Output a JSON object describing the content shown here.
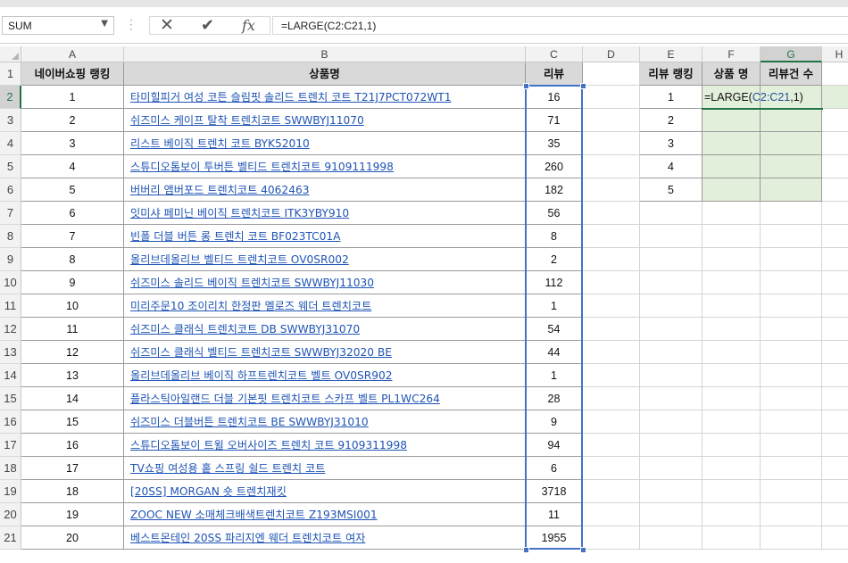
{
  "formula_bar": {
    "name_box": "SUM",
    "cancel_icon": "✕",
    "enter_icon": "✔",
    "fx_icon": "fx",
    "formula": "=LARGE(C2:C21,1)"
  },
  "columns": [
    "A",
    "B",
    "C",
    "D",
    "E",
    "F",
    "G",
    "H"
  ],
  "rows": [
    "1",
    "2",
    "3",
    "4",
    "5",
    "6",
    "7",
    "8",
    "9",
    "10",
    "11",
    "12",
    "13",
    "14",
    "15",
    "16",
    "17",
    "18",
    "19",
    "20",
    "21"
  ],
  "table": {
    "headers": [
      "네이버쇼핑 랭킹",
      "상품명",
      "리뷰"
    ],
    "rows": [
      {
        "rank": "1",
        "name": "타미힐피거 여성 코튼 슬림핏 솔리드 트렌치 코트 T21J7PCT072WT1",
        "reviews": "16"
      },
      {
        "rank": "2",
        "name": "쉬즈미스 케이프 탈착 트렌치코트 SWWBYJ11070",
        "reviews": "71"
      },
      {
        "rank": "3",
        "name": "리스트 베이직 트렌치 코트 BYK52010",
        "reviews": "35"
      },
      {
        "rank": "4",
        "name": "스튜디오톰보이 투버튼 벨티드 트렌치코트 9109111998",
        "reviews": "260"
      },
      {
        "rank": "5",
        "name": "버버리 앰버포드 트렌치코트 4062463",
        "reviews": "182"
      },
      {
        "rank": "6",
        "name": "잇미샤 페미닌 베이직 트렌치코트 ITK3YBY910",
        "reviews": "56"
      },
      {
        "rank": "7",
        "name": "빈폴 더블 버튼 롱 트렌치 코트 BF023TC01A",
        "reviews": "8"
      },
      {
        "rank": "8",
        "name": "올리브데올리브 벨티드 트렌치코트 OV0SR002",
        "reviews": "2"
      },
      {
        "rank": "9",
        "name": "쉬즈미스 솔리드 베이직 트렌치코트 SWWBYJ11030",
        "reviews": "112"
      },
      {
        "rank": "10",
        "name": "미리주문10 조이리치 한정판 멜로즈 웨더 트렌치코트",
        "reviews": "1"
      },
      {
        "rank": "11",
        "name": "쉬즈미스 클래식 트렌치코트 DB SWWBYJ31070",
        "reviews": "54"
      },
      {
        "rank": "12",
        "name": "쉬즈미스 클래식 벨티드 트렌치코트 SWWBYJ32020 BE",
        "reviews": "44"
      },
      {
        "rank": "13",
        "name": "올리브데올리브 베이직 하프트렌치코트 벨트 OV0SR902",
        "reviews": "1"
      },
      {
        "rank": "14",
        "name": "플라스틱아일랜드 더블 기본핏 트렌치코트 스카프 벨트 PL1WC264",
        "reviews": "28"
      },
      {
        "rank": "15",
        "name": "쉬즈미스 더블버튼 트렌치코트 BE SWWBYJ31010",
        "reviews": "9"
      },
      {
        "rank": "16",
        "name": "스튜디오톰보이 트윌 오버사이즈 트렌치 코트 9109311998",
        "reviews": "94"
      },
      {
        "rank": "17",
        "name": "TV쇼핑 여성용 홑 스프링 쉴드 트렌치 코트",
        "reviews": "6"
      },
      {
        "rank": "18",
        "name": "[20SS] MORGAN 숏 트렌치재킷",
        "reviews": "3718"
      },
      {
        "rank": "19",
        "name": "ZOOC NEW 소매체크배색트렌치코트 Z193MSI001",
        "reviews": "11"
      },
      {
        "rank": "20",
        "name": "베스트몬테인 20SS 파리지엔 웨더 트렌치코트 여자",
        "reviews": "1955"
      }
    ]
  },
  "summary": {
    "headers": [
      "리뷰 랭킹",
      "상품 명",
      "리뷰건 수"
    ],
    "ranks": [
      "1",
      "2",
      "3",
      "4",
      "5"
    ],
    "editing_formula": {
      "prefix": "=LARGE(",
      "ref": "C2:C21",
      "suffix": ",1)"
    }
  },
  "colors": {
    "header_fill": "#d9d9d9",
    "link": "#1f54b5",
    "input_fill": "#e2efda",
    "range_highlight": "#4472c4",
    "excel_green": "#217346"
  }
}
